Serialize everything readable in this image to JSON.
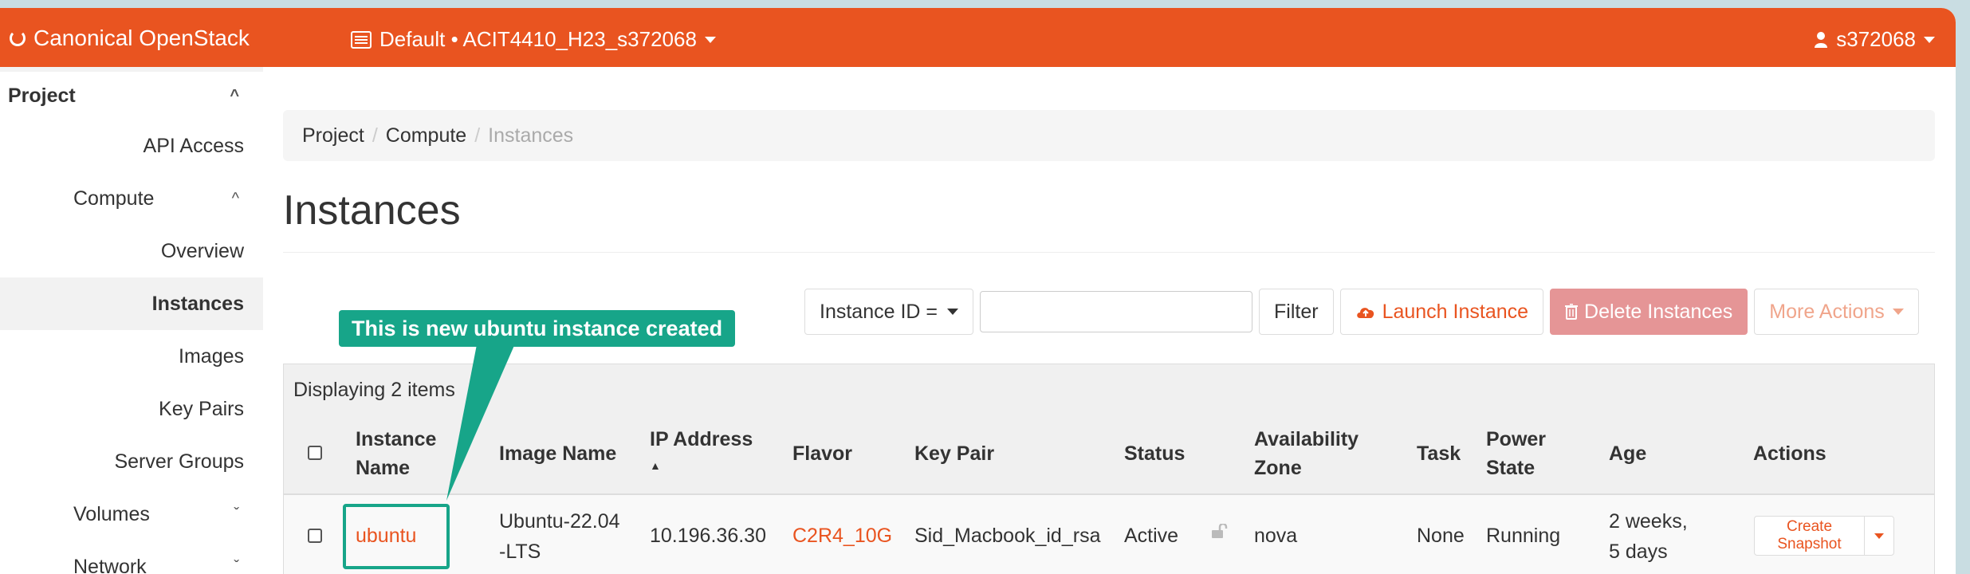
{
  "brand": {
    "name": "Canonical OpenStack"
  },
  "header": {
    "project": "Default • ACIT4410_H23_s372068",
    "user": "s372068"
  },
  "sidebar": {
    "section": "Project",
    "items": [
      {
        "label": "API Access"
      },
      {
        "label": "Compute"
      },
      {
        "label": "Overview"
      },
      {
        "label": "Instances"
      },
      {
        "label": "Images"
      },
      {
        "label": "Key Pairs"
      },
      {
        "label": "Server Groups"
      },
      {
        "label": "Volumes"
      },
      {
        "label": "Network"
      }
    ]
  },
  "breadcrumb": {
    "project": "Project",
    "compute": "Compute",
    "current": "Instances"
  },
  "page": {
    "title": "Instances"
  },
  "toolbar": {
    "filter_select": "Instance ID =",
    "filter_value": "",
    "filter_button": "Filter",
    "launch": "Launch Instance",
    "delete": "Delete Instances",
    "more": "More Actions"
  },
  "table": {
    "displaying": "Displaying 2 items",
    "headers": {
      "name_1": "Instance",
      "name_2": "Name",
      "image": "Image Name",
      "ip": "IP Address",
      "flavor": "Flavor",
      "keypair": "Key Pair",
      "status": "Status",
      "zone_1": "Availability",
      "zone_2": "Zone",
      "task": "Task",
      "power_1": "Power",
      "power_2": "State",
      "age": "Age",
      "actions": "Actions"
    },
    "rows": [
      {
        "name": "ubuntu",
        "image_1": "Ubuntu-22.04",
        "image_2": "-LTS",
        "ip": "10.196.36.30",
        "flavor": "C2R4_10G",
        "keypair": "Sid_Macbook_id_rsa",
        "status": "Active",
        "zone": "nova",
        "task": "None",
        "power": "Running",
        "age_1": "2 weeks,",
        "age_2": "5 days",
        "action": "Create Snapshot"
      }
    ]
  },
  "annotation": {
    "text": "This is new ubuntu instance created"
  },
  "colors": {
    "brand": "#e95420",
    "annotation": "#17a589",
    "delete": "#e59596"
  }
}
